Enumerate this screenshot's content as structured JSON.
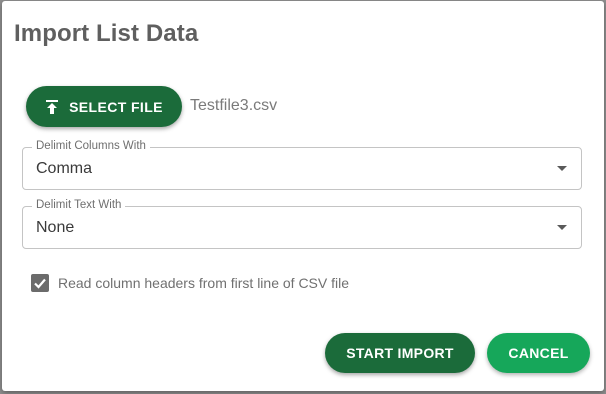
{
  "dialog": {
    "title": "Import List Data"
  },
  "select_file": {
    "label": "SELECT FILE",
    "icon": "upload-icon"
  },
  "file_name": "Testfile3.csv",
  "delimit_columns": {
    "label": "Delimit Columns With",
    "value": "Comma"
  },
  "delimit_text": {
    "label": "Delimit Text With",
    "value": "None"
  },
  "read_headers": {
    "label": "Read column headers from first line of CSV file",
    "checked": true
  },
  "actions": {
    "start_label": "START IMPORT",
    "cancel_label": "CANCEL"
  },
  "colors": {
    "primary": "#1b6b3a",
    "secondary": "#16a75a",
    "overlay": "#8f8f8f"
  }
}
